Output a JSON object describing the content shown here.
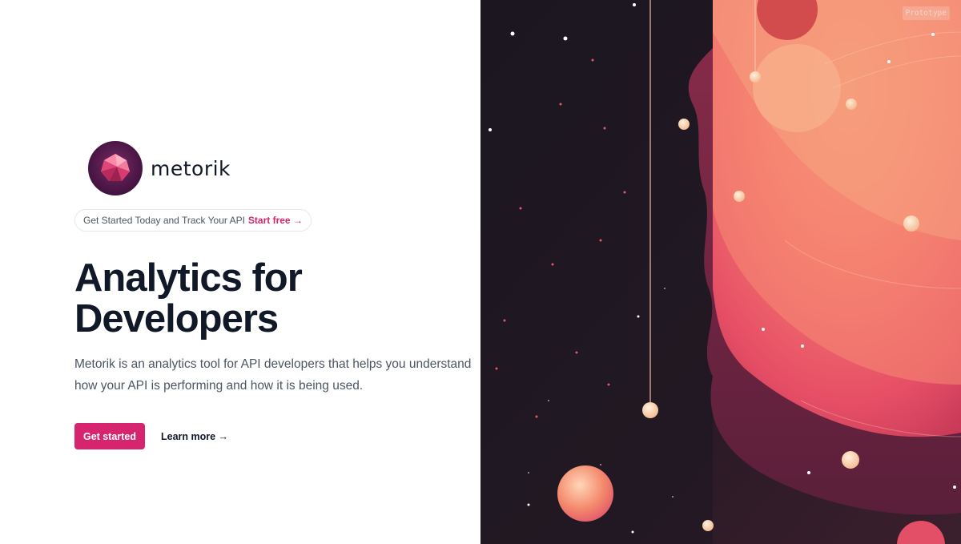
{
  "brand": {
    "name": "metorik"
  },
  "announcement": {
    "text": "Get Started Today and Track Your API",
    "link_label": "Start free →"
  },
  "hero": {
    "title_line1": "Analytics for",
    "title_line2": "Developers",
    "description": "Metorik is an analytics tool for API developers that helps you understand how your API is performing and how it is being used."
  },
  "actions": {
    "primary_label": "Get started",
    "secondary_label": "Learn more →"
  },
  "illustration": {
    "badge": "Prototype"
  },
  "colors": {
    "accent": "#d6246e",
    "text": "#111827",
    "muted": "#4b5563"
  }
}
